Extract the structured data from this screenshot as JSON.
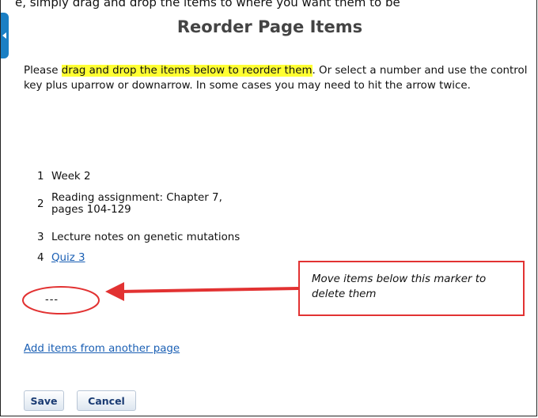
{
  "top_cut_text": "e, simply drag and drop the items to where you want them to be",
  "page_title": "Reorder Page Items",
  "intro": {
    "before": "Please ",
    "highlight": "drag and drop the items below to reorder them",
    "after": ". Or select a number and use the control key plus uparrow or downarrow. In some cases you may need to hit the arrow twice."
  },
  "items": [
    {
      "num": "1",
      "line1": "Week 2",
      "line2": ""
    },
    {
      "num": "2",
      "line1": "Reading assignment: Chapter 7,",
      "line2": "pages 104-129"
    },
    {
      "num": "3",
      "line1": "Lecture notes on genetic mutations",
      "line2": ""
    },
    {
      "num": "4",
      "line1": "Quiz 3",
      "line2": ""
    }
  ],
  "delete_marker": "---",
  "callout_text": "Move items below this marker to delete them",
  "add_items_link": "Add items from another page",
  "buttons": {
    "save": "Save",
    "cancel": "Cancel"
  },
  "colors": {
    "highlight": "#ffff33",
    "link": "#1a5fb4",
    "annotation_red": "#e23232",
    "side_tab": "#1a7fc4"
  }
}
